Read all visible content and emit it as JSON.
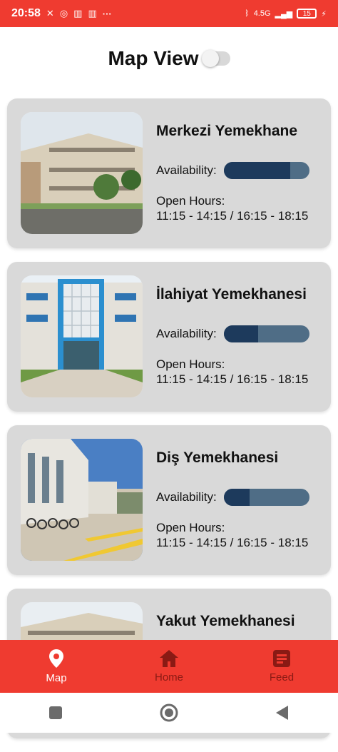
{
  "status_bar": {
    "time": "20:58",
    "network": "4.5G",
    "battery": "15",
    "more": "···"
  },
  "header": {
    "title": "Map View"
  },
  "cafeterias": [
    {
      "name": "Merkezi Yemekhane",
      "availability_label": "Availability:",
      "availability": 0.78,
      "hours_label": "Open Hours:",
      "hours": "11:15 - 14:15 / 16:15 - 18:15"
    },
    {
      "name": "İlahiyat Yemekhanesi",
      "availability_label": "Availability:",
      "availability": 0.4,
      "hours_label": "Open Hours:",
      "hours": "11:15 - 14:15 / 16:15 - 18:15"
    },
    {
      "name": "Diş Yemekhanesi",
      "availability_label": "Availability:",
      "availability": 0.3,
      "hours_label": "Open Hours:",
      "hours": "11:15 - 14:15 / 16:15 - 18:15"
    },
    {
      "name": "Yakut Yemekhanesi"
    }
  ],
  "nav": [
    {
      "label": "Map",
      "icon": "map-pin-icon",
      "active": true
    },
    {
      "label": "Home",
      "icon": "home-icon",
      "active": false
    },
    {
      "label": "Feed",
      "icon": "feed-icon",
      "active": false
    }
  ],
  "colors": {
    "accent": "#ef3b30",
    "bar_fill": "#1d3a5c",
    "bar_track": "#4f6d86",
    "card_bg": "#d9d9d9"
  }
}
